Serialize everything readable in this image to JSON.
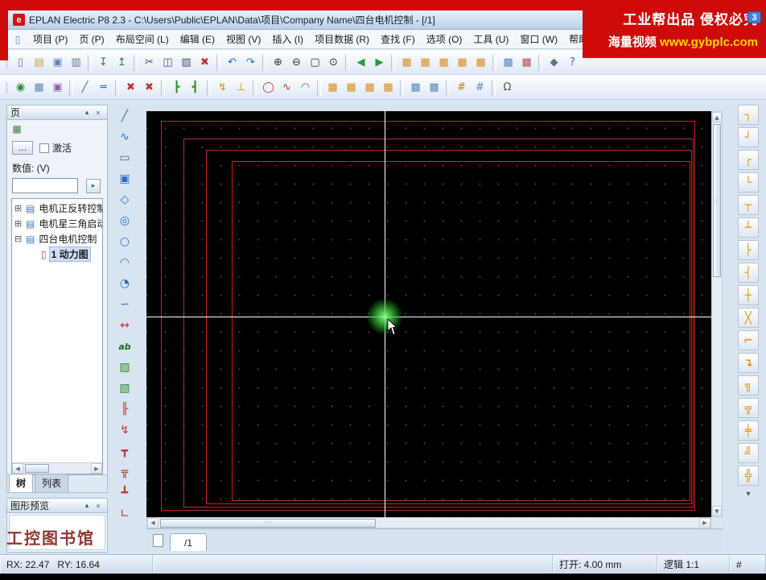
{
  "banner": {
    "line1": "工业帮出品 侵权必究",
    "line2_left": "海量视频",
    "line2_right": "www.gybplc.com",
    "badge": "3"
  },
  "titlebar": {
    "icon_letter": "e",
    "title": "EPLAN Electric P8 2.3 - C:\\Users\\Public\\EPLAN\\Data\\项目\\Company Name\\四台电机控制 - [/1]"
  },
  "menubar": {
    "doc_icon": "▯",
    "items": [
      {
        "name": "menu-project",
        "label": "项目 (P)"
      },
      {
        "name": "menu-page",
        "label": "页 (P)"
      },
      {
        "name": "menu-layout-space",
        "label": "布局空间 (L)"
      },
      {
        "name": "menu-edit",
        "label": "编辑 (E)"
      },
      {
        "name": "menu-view",
        "label": "视图 (V)"
      },
      {
        "name": "menu-insert",
        "label": "插入 (I)"
      },
      {
        "name": "menu-project-data",
        "label": "项目数据 (R)"
      },
      {
        "name": "menu-find",
        "label": "查找 (F)"
      },
      {
        "name": "menu-options",
        "label": "选项 (O)"
      },
      {
        "name": "menu-utilities",
        "label": "工具 (U)"
      },
      {
        "name": "menu-window",
        "label": "窗口 (W)"
      },
      {
        "name": "menu-help",
        "label": "帮助 (H)"
      }
    ]
  },
  "toolbar1": {
    "icons": [
      {
        "name": "toolbar-drag-handle",
        "glyph": "┊",
        "cls": "handle"
      },
      {
        "name": "new-page-icon",
        "glyph": "▯",
        "color": "#5b87b8"
      },
      {
        "name": "open-project-icon",
        "glyph": "▤",
        "color": "#c8a24a"
      },
      {
        "name": "page-properties-icon",
        "glyph": "▣",
        "color": "#5b87b8"
      },
      {
        "name": "print-icon",
        "glyph": "▥",
        "color": "#667788"
      },
      {
        "name": "toolbar-separator",
        "glyph": "",
        "cls": "sep"
      },
      {
        "name": "import-icon",
        "glyph": "↧",
        "color": "#2e7d32"
      },
      {
        "name": "export-icon",
        "glyph": "↥",
        "color": "#2e7d32"
      },
      {
        "name": "toolbar-separator",
        "glyph": "",
        "cls": "sep"
      },
      {
        "name": "cut-icon",
        "glyph": "✂",
        "color": "#445566"
      },
      {
        "name": "copy-icon",
        "glyph": "◫",
        "color": "#445566"
      },
      {
        "name": "paste-icon",
        "glyph": "▧",
        "color": "#445566"
      },
      {
        "name": "delete-icon",
        "glyph": "✖",
        "color": "#c03434"
      },
      {
        "name": "toolbar-separator",
        "glyph": "",
        "cls": "sep"
      },
      {
        "name": "undo-icon",
        "glyph": "↶",
        "color": "#2a6fbd"
      },
      {
        "name": "redo-icon",
        "glyph": "↷",
        "color": "#2a6fbd"
      },
      {
        "name": "toolbar-separator",
        "glyph": "",
        "cls": "sep"
      },
      {
        "name": "zoom-in-icon",
        "glyph": "⊕",
        "color": "#333333"
      },
      {
        "name": "zoom-out-icon",
        "glyph": "⊖",
        "color": "#333333"
      },
      {
        "name": "zoom-window-icon",
        "glyph": "▢",
        "color": "#333333"
      },
      {
        "name": "zoom-fit-icon",
        "glyph": "⊙",
        "color": "#333333"
      },
      {
        "name": "toolbar-separator",
        "glyph": "",
        "cls": "sep"
      },
      {
        "name": "previous-page-icon",
        "glyph": "◀",
        "color": "#1f9d3a"
      },
      {
        "name": "next-page-icon",
        "glyph": "▶",
        "color": "#1f9d3a"
      },
      {
        "name": "toolbar-separator",
        "glyph": "",
        "cls": "sep"
      },
      {
        "name": "device-navigator-icon",
        "glyph": "▦",
        "color": "#d98b1f"
      },
      {
        "name": "page-navigator-icon",
        "glyph": "▦",
        "color": "#d98b1f"
      },
      {
        "name": "parts-navigator-icon",
        "glyph": "▦",
        "color": "#d98b1f"
      },
      {
        "name": "message-management-icon",
        "glyph": "▦",
        "color": "#d98b1f"
      },
      {
        "name": "connections-navigator-icon",
        "glyph": "▦",
        "color": "#d98b1f"
      },
      {
        "name": "toolbar-separator",
        "glyph": "",
        "cls": "sep"
      },
      {
        "name": "layer-management-icon",
        "glyph": "▩",
        "color": "#5b87b8"
      },
      {
        "name": "plot-frame-icon",
        "glyph": "▩",
        "color": "#b05050"
      },
      {
        "name": "toolbar-separator",
        "glyph": "",
        "cls": "sep"
      },
      {
        "name": "pin-icon",
        "glyph": "◆",
        "color": "#60708a"
      },
      {
        "name": "help-icon",
        "glyph": "?",
        "color": "#2a6fbd"
      }
    ]
  },
  "toolbar2": {
    "icons": [
      {
        "name": "toolbar-drag-handle",
        "glyph": "┊",
        "cls": "handle"
      },
      {
        "name": "insert-symbol-icon",
        "glyph": "◉",
        "color": "#2e8b2e"
      },
      {
        "name": "insert-macro-icon",
        "glyph": "▦",
        "color": "#5b87b8"
      },
      {
        "name": "insert-device-icon",
        "glyph": "▣",
        "color": "#8a5fb0"
      },
      {
        "name": "toolbar-separator",
        "glyph": "",
        "cls": "sep"
      },
      {
        "name": "connection-line-icon",
        "glyph": "╱",
        "color": "#2a6fbd"
      },
      {
        "name": "busbar-icon",
        "glyph": "═",
        "color": "#2a6fbd"
      },
      {
        "name": "toolbar-separator",
        "glyph": "",
        "cls": "sep"
      },
      {
        "name": "delete-placement-icon",
        "glyph": "✖",
        "color": "#c03434"
      },
      {
        "name": "remove-connection-icon",
        "glyph": "✖",
        "color": "#c03434"
      },
      {
        "name": "toolbar-separator",
        "glyph": "",
        "cls": "sep"
      },
      {
        "name": "t-node-left-icon",
        "glyph": "┣",
        "color": "#2e8b2e"
      },
      {
        "name": "t-node-right-icon",
        "glyph": "┫",
        "color": "#2e8b2e"
      },
      {
        "name": "toolbar-separator",
        "glyph": "",
        "cls": "sep"
      },
      {
        "name": "interruption-point-icon",
        "glyph": "↯",
        "color": "#d98b1f"
      },
      {
        "name": "potential-icon",
        "glyph": "⊥",
        "color": "#d98b1f"
      },
      {
        "name": "toolbar-separator",
        "glyph": "",
        "cls": "sep"
      },
      {
        "name": "terminal-icon",
        "glyph": "◯",
        "color": "#c03434"
      },
      {
        "name": "cable-definition-icon",
        "glyph": "∿",
        "color": "#c03434"
      },
      {
        "name": "shield-icon",
        "glyph": "◠",
        "color": "#c03434"
      },
      {
        "name": "toolbar-separator",
        "glyph": "",
        "cls": "sep"
      },
      {
        "name": "terminal-navigator-icon",
        "glyph": "▦",
        "color": "#d98b1f"
      },
      {
        "name": "cable-navigator-icon",
        "glyph": "▦",
        "color": "#d98b1f"
      },
      {
        "name": "plc-navigator-icon",
        "glyph": "▦",
        "color": "#d98b1f"
      },
      {
        "name": "interruption-navigator-icon",
        "glyph": "▦",
        "color": "#d98b1f"
      },
      {
        "name": "toolbar-separator",
        "glyph": "",
        "cls": "sep"
      },
      {
        "name": "edit-functions-icon",
        "glyph": "▩",
        "color": "#5b87b8"
      },
      {
        "name": "edit-properties-icon",
        "glyph": "▩",
        "color": "#5b87b8"
      },
      {
        "name": "toolbar-separator",
        "glyph": "",
        "cls": "sep"
      },
      {
        "name": "numbering-icon",
        "glyph": "#",
        "color": "#b8860b"
      },
      {
        "name": "numbering-settings-icon",
        "glyph": "#",
        "color": "#5b87b8"
      },
      {
        "name": "toolbar-separator",
        "glyph": "",
        "cls": "sep"
      },
      {
        "name": "ohm-icon",
        "glyph": "Ω",
        "color": "#555555"
      }
    ]
  },
  "left_tools": {
    "icons": [
      {
        "name": "line-tool-icon",
        "glyph": "╱",
        "color": "#2a6fbd"
      },
      {
        "name": "polyline-tool-icon",
        "glyph": "∿",
        "color": "#2a6fbd"
      },
      {
        "name": "rectangle-tool-icon",
        "glyph": "▭",
        "color": "#2a6fbd"
      },
      {
        "name": "rectangle-corner-tool-icon",
        "glyph": "▣",
        "color": "#2a6fbd"
      },
      {
        "name": "polygon-tool-icon",
        "glyph": "◇",
        "color": "#2a6fbd"
      },
      {
        "name": "circle-tool-icon",
        "glyph": "◎",
        "color": "#2a6fbd"
      },
      {
        "name": "ellipse-tool-icon",
        "glyph": "○",
        "color": "#2a6fbd"
      },
      {
        "name": "arc-tool-icon",
        "glyph": "◠",
        "color": "#2a6fbd"
      },
      {
        "name": "sector-tool-icon",
        "glyph": "◔",
        "color": "#2a6fbd"
      },
      {
        "name": "spline-tool-icon",
        "glyph": "∽",
        "color": "#2a6fbd"
      },
      {
        "name": "dimension-tool-icon",
        "glyph": "↔",
        "color": "#c03434"
      },
      {
        "name": "text-tool-icon",
        "glyph": "ab",
        "color": "#1a6a1a",
        "cls": "txt"
      },
      {
        "name": "hatch-tool-icon",
        "glyph": "▨",
        "color": "#2e8b2e"
      },
      {
        "name": "image-tool-icon",
        "glyph": "▧",
        "color": "#2e8b2e"
      },
      {
        "name": "dimension-baseline-icon",
        "glyph": "╟",
        "color": "#c03434"
      },
      {
        "name": "lightning-tool-icon",
        "glyph": "↯",
        "color": "#c03434"
      },
      {
        "name": "t-symbol-up-icon",
        "glyph": "┳",
        "color": "#c03434"
      },
      {
        "name": "t-symbol-double-icon",
        "glyph": "╦",
        "color": "#c03434"
      },
      {
        "name": "t-symbol-down-icon",
        "glyph": "┻",
        "color": "#c03434"
      },
      {
        "name": "angle-tool-icon",
        "glyph": "∟",
        "color": "#c03434"
      }
    ]
  },
  "right_tools": {
    "icons": [
      {
        "name": "angle-down-left-icon",
        "glyph": "┐",
        "color": "#dd9c10"
      },
      {
        "name": "angle-up-left-icon",
        "glyph": "┘",
        "color": "#dd9c10"
      },
      {
        "name": "angle-down-right-icon",
        "glyph": "┌",
        "color": "#dd9c10"
      },
      {
        "name": "angle-up-right-icon",
        "glyph": "└",
        "color": "#dd9c10"
      },
      {
        "name": "t-node-down-icon",
        "glyph": "┬",
        "color": "#dd9c10"
      },
      {
        "name": "t-node-up-icon",
        "glyph": "┴",
        "color": "#dd9c10"
      },
      {
        "name": "t-node-right-icon",
        "glyph": "├",
        "color": "#dd9c10"
      },
      {
        "name": "t-node-left-icon",
        "glyph": "┤",
        "color": "#dd9c10"
      },
      {
        "name": "cross-connection-icon",
        "glyph": "┼",
        "color": "#dd9c10"
      },
      {
        "name": "crossing-icon",
        "glyph": "╳",
        "color": "#dd9c10"
      },
      {
        "name": "corner-jump-icon",
        "glyph": "⌐",
        "color": "#dd9c10"
      },
      {
        "name": "jump-down-icon",
        "glyph": "↴",
        "color": "#dd9c10"
      },
      {
        "name": "double-angle-icon",
        "glyph": "╗",
        "color": "#dd9c10"
      },
      {
        "name": "double-t-node-icon",
        "glyph": "╦",
        "color": "#dd9c10"
      },
      {
        "name": "break-point-icon",
        "glyph": "╪",
        "color": "#dd9c10"
      },
      {
        "name": "double-corner-icon",
        "glyph": "╝",
        "color": "#dd9c10"
      },
      {
        "name": "double-cross-icon",
        "glyph": "╬",
        "color": "#dd9c10"
      },
      {
        "name": "more-symbols-icon",
        "glyph": "▾",
        "cls": "more"
      }
    ]
  },
  "page_panel": {
    "header": "页",
    "controls": {
      "collapse": "▴",
      "close": "×"
    },
    "filter_icon": "▦",
    "browse_label": "…",
    "activate_label": "激活",
    "value_label": "数值: (V)",
    "apply_glyph": "▸",
    "tree": [
      {
        "name": "tree-item-project-1",
        "expand": "⊞",
        "icon": "▤",
        "color": "#4a7ab5",
        "label": "电机正反转控制"
      },
      {
        "name": "tree-item-project-2",
        "expand": "⊞",
        "icon": "▤",
        "color": "#4a7ab5",
        "label": "电机星三角启动"
      },
      {
        "name": "tree-item-project-3",
        "expand": "⊟",
        "icon": "▤",
        "color": "#4a7ab5",
        "label": "四台电机控制"
      },
      {
        "name": "tree-item-page-1",
        "expand": "",
        "icon": "▯",
        "color": "#b04a4a",
        "label": "1 动力图",
        "cls": "indent sel"
      }
    ],
    "tabs": [
      "树",
      "列表"
    ]
  },
  "preview_panel": {
    "title": "图形预览",
    "controls": {
      "collapse": "▴",
      "close": "×"
    }
  },
  "canvas": {
    "tab_label": "/1"
  },
  "scroll_icons": {
    "up": "▲",
    "down": "▼",
    "left": "◀",
    "right": "▶",
    "dots_h": "⋯",
    "dots_v": "⋮"
  },
  "statusbar": {
    "rx": "RX: 22.47",
    "ry": "RY: 16.64",
    "grid": "打开: 4.00 mm",
    "scale": "逻辑 1:1",
    "hash": "#"
  },
  "watermark": {
    "text": "工控图书馆"
  }
}
